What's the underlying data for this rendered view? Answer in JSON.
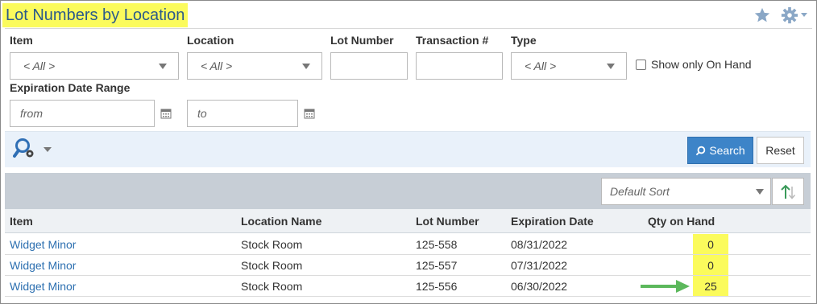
{
  "header": {
    "title": "Lot Numbers by Location",
    "icons": [
      "star-icon",
      "gear-icon"
    ]
  },
  "filters": {
    "item": {
      "label": "Item",
      "value": "< All >"
    },
    "location": {
      "label": "Location",
      "value": "< All >"
    },
    "lot_number": {
      "label": "Lot Number",
      "value": ""
    },
    "transaction": {
      "label": "Transaction #",
      "value": ""
    },
    "type": {
      "label": "Type",
      "value": "< All >"
    },
    "on_hand": {
      "label": "Show only On Hand",
      "checked": false
    },
    "expiration": {
      "label": "Expiration Date Range",
      "from_placeholder": "from",
      "to_placeholder": "to"
    }
  },
  "toolbar": {
    "search_label": "Search",
    "reset_label": "Reset"
  },
  "results": {
    "sort_value": "Default Sort",
    "columns": [
      "Item",
      "Location Name",
      "Lot Number",
      "Expiration Date",
      "Qty on Hand"
    ],
    "rows": [
      {
        "item": "Widget Minor",
        "location": "Stock Room",
        "lot": "125-558",
        "expiration": "08/31/2022",
        "qty": "0"
      },
      {
        "item": "Widget Minor",
        "location": "Stock Room",
        "lot": "125-557",
        "expiration": "07/31/2022",
        "qty": "0"
      },
      {
        "item": "Widget Minor",
        "location": "Stock Room",
        "lot": "125-556",
        "expiration": "06/30/2022",
        "qty": "25"
      }
    ]
  },
  "colors": {
    "title": "#2b5a8a",
    "highlight": "#fbfb5c",
    "accent": "#3d84c8",
    "link": "#2c6fb0",
    "arrow": "#5cb85c"
  }
}
